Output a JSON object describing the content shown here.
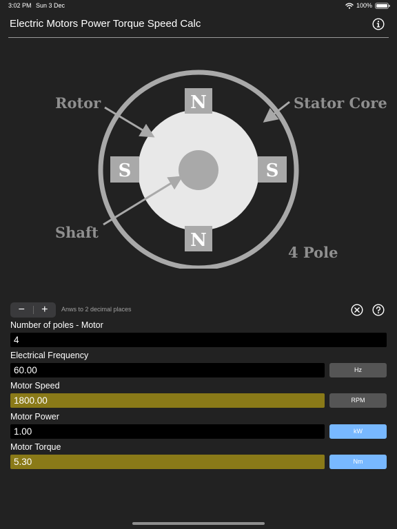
{
  "status_bar": {
    "time": "3:02 PM",
    "date": "Sun 3 Dec",
    "battery": "100%",
    "battery_level": 1.0
  },
  "header": {
    "title": "Electric Motors Power Torque Speed Calc",
    "info_icon": "info-icon"
  },
  "diagram": {
    "rotor_label": "Rotor",
    "stator_label": "Stator Core",
    "shaft_label": "Shaft",
    "pole_count_label": "4 Pole",
    "pole_top": "N",
    "pole_bottom": "N",
    "pole_left": "S",
    "pole_right": "S"
  },
  "toolbar": {
    "minus_label": "−",
    "plus_label": "+",
    "decimals_note": "Anws to 2 decimal places",
    "clear_icon": "clear-icon",
    "help_icon": "help-icon"
  },
  "fields": {
    "poles": {
      "label": "Number of poles - Motor",
      "value": "4"
    },
    "frequency": {
      "label": "Electrical Frequency",
      "value": "60.00",
      "unit": "Hz"
    },
    "speed": {
      "label": "Motor Speed",
      "value": "1800.00",
      "unit": "RPM"
    },
    "power": {
      "label": "Motor Power",
      "value": "1.00",
      "unit": "kW"
    },
    "torque": {
      "label": "Motor Torque",
      "value": "5.30",
      "unit": "Nm"
    }
  },
  "colors": {
    "background": "#222222",
    "input_background": "#000000",
    "result_background": "#8a7a18",
    "unit_gray": "#555555",
    "unit_blue": "#78b8ff",
    "diagram_gray": "#a9a9a9"
  }
}
